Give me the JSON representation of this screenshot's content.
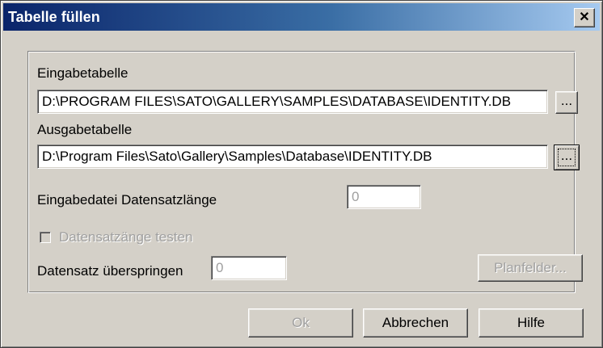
{
  "window": {
    "title": "Tabelle füllen",
    "close_glyph": "✕"
  },
  "input_table": {
    "label": "Eingabetabelle",
    "value": "D:\\PROGRAM FILES\\SATO\\GALLERY\\SAMPLES\\DATABASE\\IDENTITY.DB",
    "browse_label": "..."
  },
  "output_table": {
    "label": "Ausgabetabelle",
    "value": "D:\\Program Files\\Sato\\Gallery\\Samples\\Database\\IDENTITY.DB",
    "browse_label": "..."
  },
  "record_length": {
    "label": "Eingabedatei Datensatzlänge",
    "value": "0"
  },
  "test_record_length": {
    "label": "Datensatzänge testen",
    "checked": false
  },
  "skip_records": {
    "label": "Datensatz überspringen",
    "value": "0"
  },
  "buttons": {
    "plan_fields": "Planfelder...",
    "ok": "Ok",
    "cancel": "Abbrechen",
    "help": "Hilfe"
  }
}
